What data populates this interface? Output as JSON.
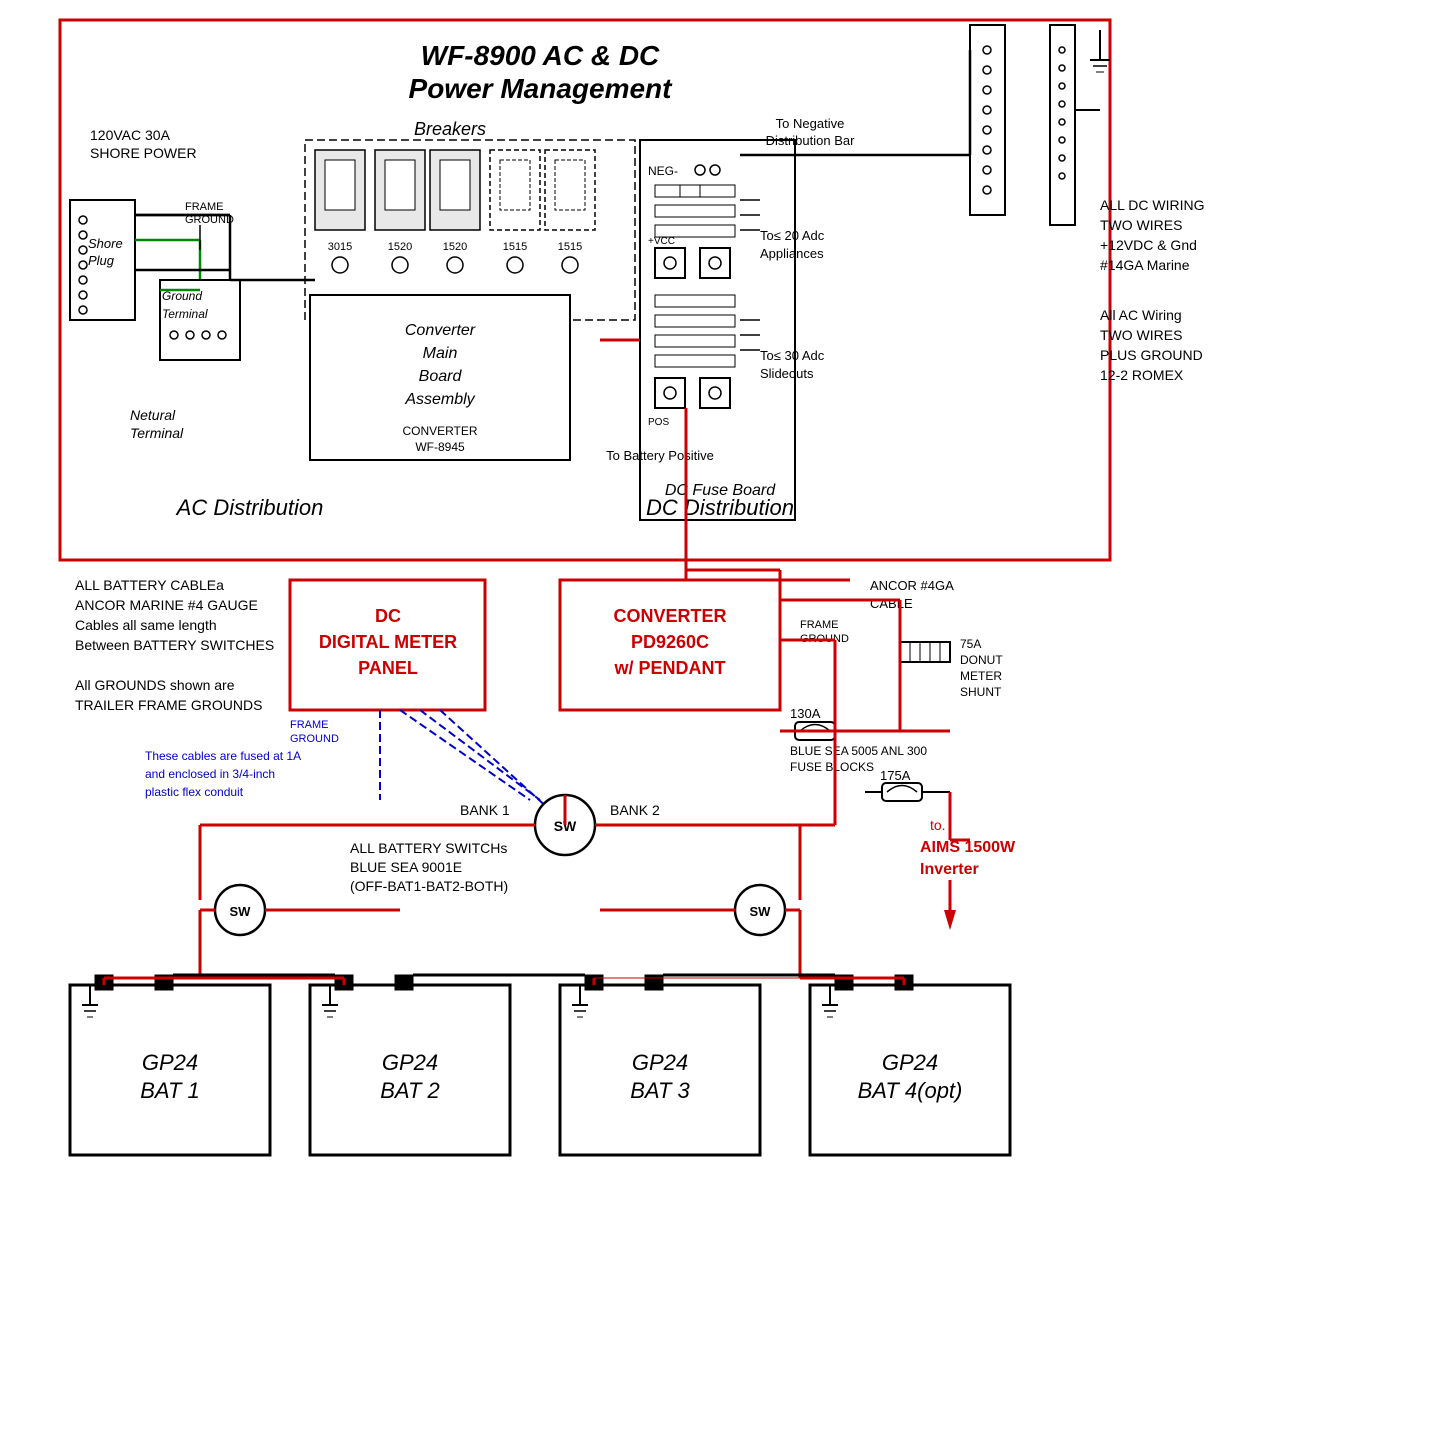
{
  "title": "WF-8900 AC & DC Power Management",
  "diagram": {
    "main_title_line1": "WF-8900 AC & DC",
    "main_title_line2": "Power Management",
    "ac_distribution_label": "AC Distribution",
    "dc_distribution_label": "DC Distribution",
    "breakers_label": "Breakers",
    "shore_power_label": "120VAC 30A\nSHORE POWER",
    "shore_plug_label": "Shore\nPlug",
    "frame_ground_label": "FRAME\nGROUND",
    "ground_terminal_label": "Ground\nTerminal",
    "neutral_terminal_label": "Netural\nTerminal",
    "converter_label": "Converter\nMain\nBoard\nAssembly",
    "converter_model": "CONVERTER\nWF-8945",
    "neg_label": "NEG-",
    "vcc_label": "+VCC",
    "pos_label": "POS",
    "to_neg_bar": "To Negative\nDistribution Bar",
    "to_20adc": "To≤ 20 Adc\nAppliances",
    "to_30adc": "To≤ 30 Adc\nSlideouts",
    "to_battery_positive": "To Battery Positive",
    "dc_fuse_board": "DC Fuse Board",
    "breaker_values": [
      "3015",
      "1520",
      "1520",
      "1515",
      "1515"
    ],
    "right_side_notes_dc": "ALL DC WIRING\nTWO WIRES\n+12VDC & Gnd\n#14GA Marine",
    "right_side_notes_ac": "All AC Wiring\nTWO WIRES\nPLUS GROUND\n12-2 ROMEX",
    "battery_cable_note": "ALL BATTERY CABLEa\nANCOR MARINE #4 GAUGE\nCables all same length\nBetween BATTERY SWITCHES",
    "grounds_note": "All GROUNDS shown are\nTRAILER FRAME GROUNDS",
    "fused_note": "These cables are fused at 1A\nand enclosed in 3/4-inch\nplastic flex conduit",
    "dc_meter_label1": "DC",
    "dc_meter_label2": "DIGITAL METER",
    "dc_meter_label3": "PANEL",
    "converter_pd_label1": "CONVERTER",
    "converter_pd_label2": "PD9260C",
    "converter_pd_label3": "w/ PENDANT",
    "frame_ground_lower": "FRAME\nGROUND",
    "frame_ground_lower2": "FRAME\nGROUND",
    "ancor_cable": "ANCOR #4GA\nCABLE",
    "donut_meter": "75A\nDONUT\nMETER\nSHUNT",
    "fuse_130a": "130A",
    "fuse_175a": "175A",
    "fuse_block_label": "BLUE SEA 5005 ANL 300\nFUSE BLOCKS",
    "bank1_label": "BANK 1",
    "bank2_label": "BANK 2",
    "sw_label": "SW",
    "battery_switch_note": "ALL BATTERY SWITCHs\nBLUE SEA 9001E\n(OFF-BAT1-BAT2-BOTH)",
    "aims_label": "to.\nAIMS 1500W\nInverter",
    "batteries": [
      {
        "label1": "GP24",
        "label2": "BAT 1"
      },
      {
        "label1": "GP24",
        "label2": "BAT 2"
      },
      {
        "label1": "GP24",
        "label2": "BAT 3"
      },
      {
        "label1": "GP24",
        "label2": "BAT 4(opt)"
      }
    ]
  },
  "colors": {
    "red_wire": "#cc0000",
    "green_wire": "#008800",
    "black_wire": "#000000",
    "blue_wire": "#0000cc",
    "border_red": "#cc0000",
    "dc_meter_red": "#cc0000",
    "converter_red": "#cc0000",
    "aims_red": "#cc0000",
    "text_blue": "#0000cc",
    "background": "#ffffff",
    "box_fill": "#ffffff",
    "box_stroke": "#000000"
  }
}
